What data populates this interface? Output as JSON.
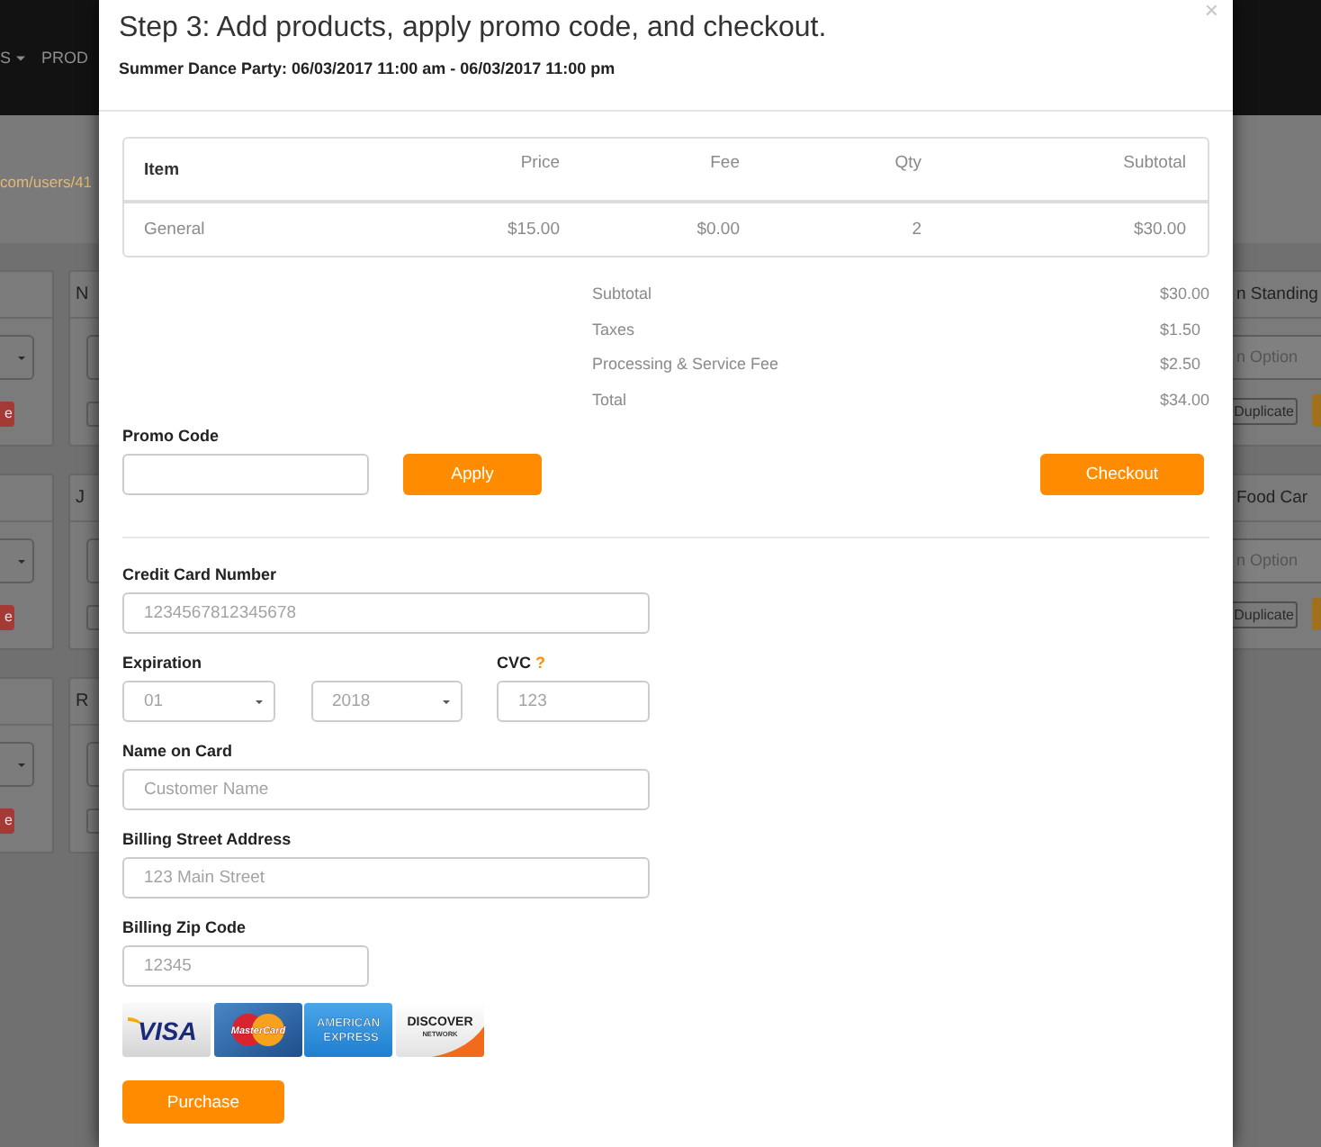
{
  "background": {
    "nav_items": [
      {
        "label": "S",
        "kind": "dropdown"
      },
      {
        "label": "PROD",
        "kind": "link"
      }
    ],
    "link": "com/users/41",
    "left_rows": [
      {
        "edge_button": "e",
        "title": "N"
      },
      {
        "edge_button": "e",
        "title": "J"
      },
      {
        "edge_button": "e",
        "title": "R"
      }
    ],
    "right_cards": [
      {
        "title": "n Standing",
        "selected_option": "n Option",
        "button": "Duplicate"
      },
      {
        "title": "Food Car",
        "selected_option": "n Option",
        "button": "Duplicate"
      }
    ]
  },
  "modal": {
    "title": "Step 3: Add products, apply promo code, and checkout.",
    "subtitle": "Summer Dance Party: 06/03/2017 11:00 am - 06/03/2017 11:00 pm",
    "close": "×",
    "table": {
      "columns": [
        "Item",
        "Price",
        "Fee",
        "Qty",
        "Subtotal"
      ],
      "rows": [
        [
          "General",
          "$15.00",
          "$0.00",
          "2",
          "$30.00"
        ]
      ]
    },
    "summary": [
      {
        "label": "Subtotal",
        "value": "$30.00"
      },
      {
        "label": "Taxes",
        "value": "$1.50"
      },
      {
        "label": "Processing & Service Fee",
        "value": "$2.50"
      },
      {
        "label": "Total",
        "value": "$34.00"
      }
    ],
    "promo": {
      "label": "Promo Code",
      "apply": "Apply"
    },
    "checkout": "Checkout",
    "fields": [
      {
        "kind": "long_text",
        "label": "Credit Card Number",
        "placeholder": "1234567812345678"
      },
      {
        "kind": "expiry",
        "label": "Expiration",
        "month": "01",
        "year": "2018",
        "cvc_label": "CVC",
        "cvc_help": "?",
        "cvc_placeholder": "123"
      },
      {
        "kind": "long_text",
        "label": "Name on Card",
        "placeholder": "Customer Name"
      },
      {
        "kind": "long_text",
        "label": "Billing Street Address",
        "placeholder": "123 Main Street"
      },
      {
        "kind": "short_text",
        "label": "Billing Zip Code",
        "placeholder": "12345"
      }
    ],
    "card_logos": [
      {
        "kind": "visa",
        "lines": [
          "VISA"
        ]
      },
      {
        "kind": "mastercard",
        "lines": [
          "MasterCard"
        ]
      },
      {
        "kind": "amex",
        "lines": [
          "AMERICAN",
          "EXPRESS"
        ]
      },
      {
        "kind": "discover",
        "lines": [
          "DISCOVER",
          "NETWORK"
        ]
      }
    ],
    "purchase": "Purchase"
  }
}
